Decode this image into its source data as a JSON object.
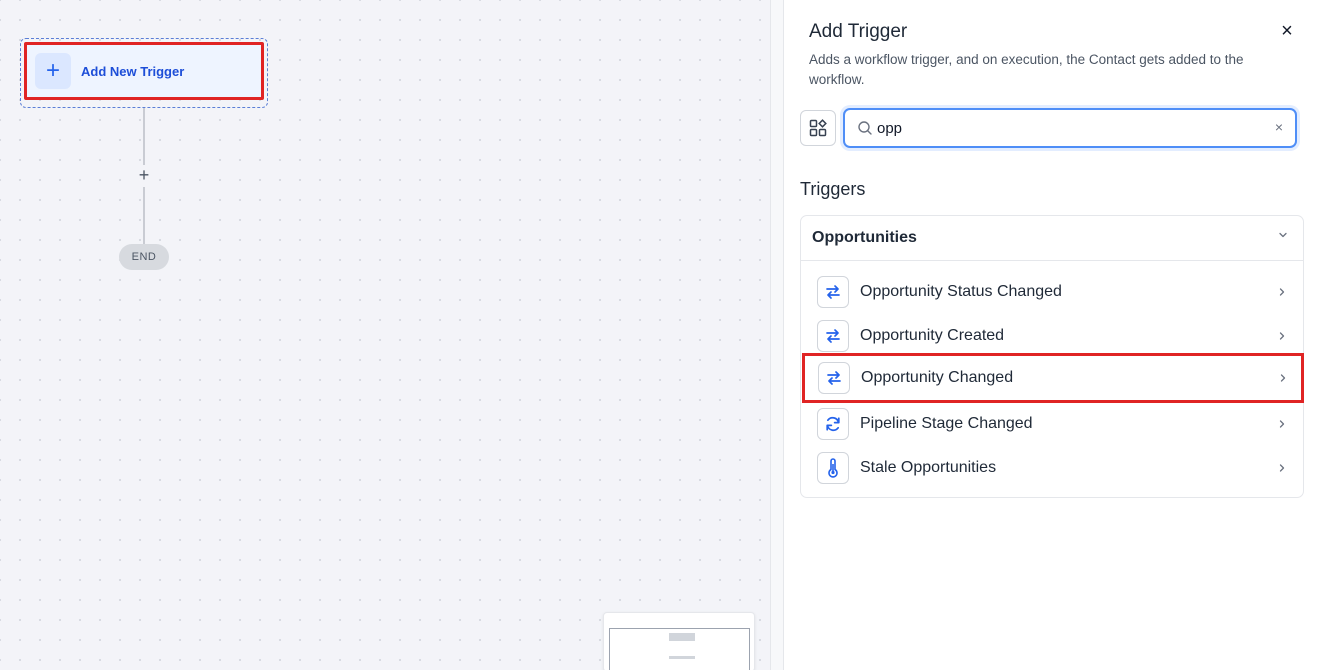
{
  "canvas": {
    "trigger_node": {
      "label": "Add New Trigger",
      "icon": "plus-icon"
    },
    "add_step": {
      "icon": "plus-icon",
      "symbol": "+"
    },
    "end_node": {
      "label": "END"
    }
  },
  "panel": {
    "title": "Add Trigger",
    "description": "Adds a workflow trigger, and on execution, the Contact gets added to the workflow.",
    "close_symbol": "×",
    "search": {
      "value": "opp",
      "placeholder": "",
      "clear_symbol": "×"
    },
    "section_title": "Triggers",
    "group": {
      "title": "Opportunities",
      "expanded": true,
      "items": [
        {
          "label": "Opportunity Status Changed",
          "icon": "swap-arrows-icon"
        },
        {
          "label": "Opportunity Created",
          "icon": "swap-arrows-icon"
        },
        {
          "label": "Opportunity Changed",
          "icon": "swap-arrows-icon",
          "highlighted": true
        },
        {
          "label": "Pipeline Stage Changed",
          "icon": "refresh-icon"
        },
        {
          "label": "Stale Opportunities",
          "icon": "thermometer-icon"
        }
      ]
    }
  },
  "colors": {
    "accent": "#2563eb",
    "highlight": "#e02424",
    "canvas_bg": "#f3f4f8"
  }
}
